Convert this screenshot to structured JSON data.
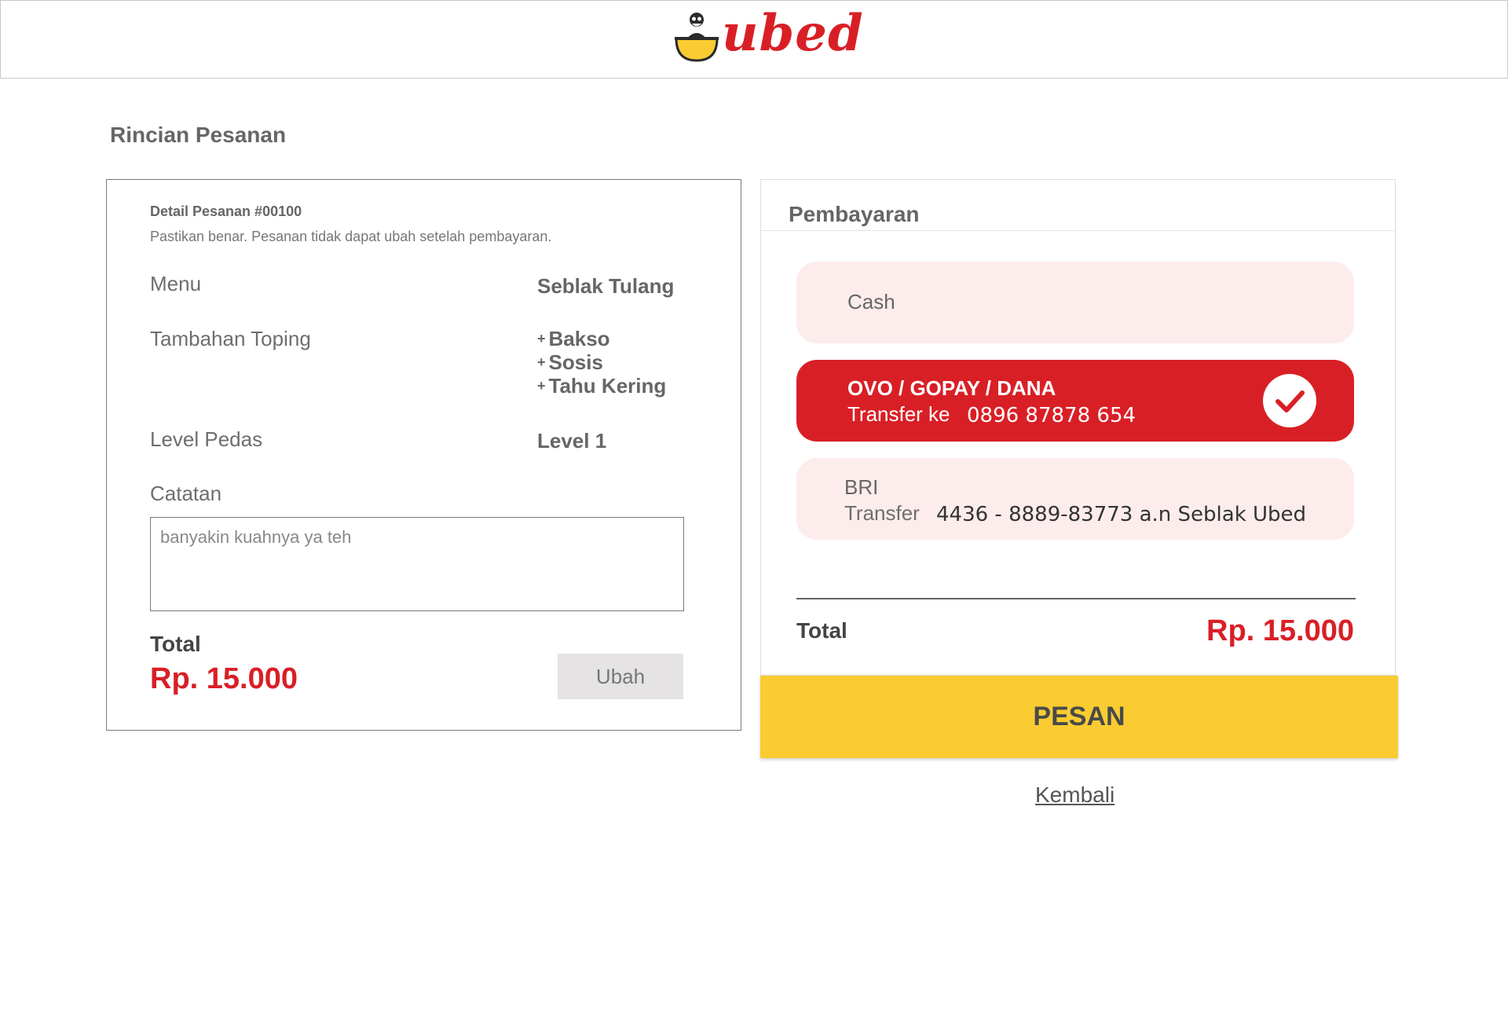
{
  "header": {
    "brand": "ubed",
    "colors": {
      "brand": "#d91f26",
      "bowl": "#facc32"
    }
  },
  "page_title": "Rincian Pesanan",
  "order": {
    "heading": "Detail Pesanan #00100",
    "note": "Pastikan benar. Pesanan tidak dapat ubah setelah pembayaran.",
    "menu_label": "Menu",
    "menu_value": "Seblak Tulang",
    "toppings_label": "Tambahan Toping",
    "toppings": [
      "Bakso",
      "Sosis",
      "Tahu Kering"
    ],
    "spice_label": "Level Pedas",
    "spice_value": "Level 1",
    "notes_label": "Catatan",
    "notes_value": "banyakin kuahnya ya teh",
    "total_label": "Total",
    "total_value": "Rp. 15.000",
    "edit_label": "Ubah"
  },
  "payment": {
    "title": "Pembayaran",
    "options": [
      {
        "name": "Cash",
        "selected": false
      },
      {
        "name": "OVO / GOPAY / DANA",
        "sub": "Transfer ke",
        "account": "0896 87878 654",
        "selected": true
      },
      {
        "name": "BRI",
        "sub": "Transfer",
        "account": "4436 - 8889-83773 a.n Seblak Ubed",
        "selected": false
      }
    ],
    "total_label": "Total",
    "total_value": "Rp. 15.000",
    "colors": {
      "accent": "#d91f26",
      "option_bg": "#fdecec",
      "submit": "#facc32"
    }
  },
  "actions": {
    "order_label": "PESAN",
    "back_label": "Kembali"
  }
}
